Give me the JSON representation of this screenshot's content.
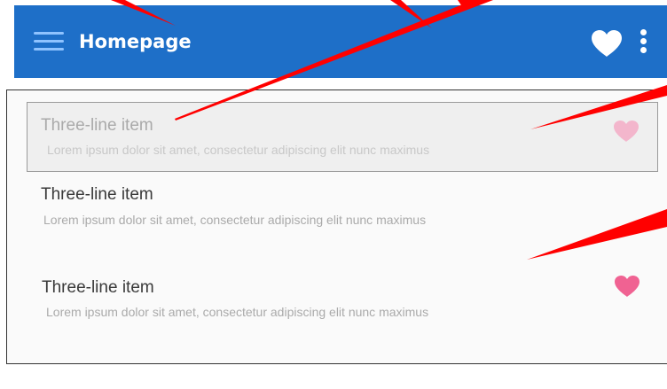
{
  "appbar": {
    "title": "Homepage",
    "background": "#1e6fc8",
    "menu_icon": "hamburger-icon",
    "favorite_icon": "heart-icon",
    "more_icon": "more-vert-icon"
  },
  "list": {
    "items": [
      {
        "title": "Three-line item",
        "subtitle": "Lorem ipsum dolor sit amet, consectetur adipiscing elit nunc maximus",
        "favorite": true,
        "heart_color": "#f3b6cc",
        "state": "pressed"
      },
      {
        "title": "Three-line item",
        "subtitle": "Lorem ipsum dolor sit amet, consectetur adipiscing elit nunc maximus",
        "favorite": false
      },
      {
        "title": "Three-line item",
        "subtitle": "Lorem ipsum dolor sit amet, consectetur adipiscing elit nunc maximus",
        "favorite": true,
        "heart_color": "#f06292"
      }
    ]
  },
  "colors": {
    "annotation": "#ff0000"
  }
}
